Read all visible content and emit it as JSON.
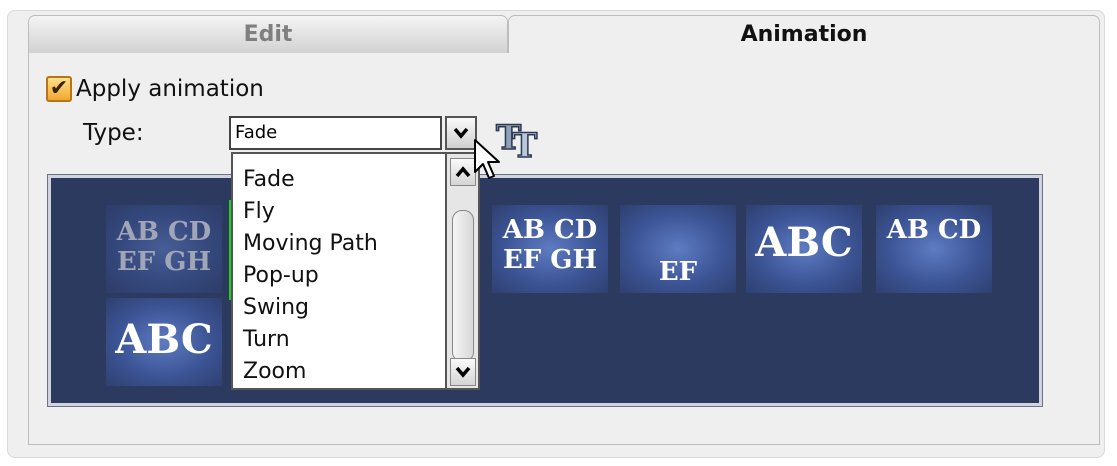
{
  "tabs": [
    {
      "label": "Edit",
      "active": false
    },
    {
      "label": "Animation",
      "active": true
    }
  ],
  "apply_animation": {
    "label": "Apply animation",
    "checked": true
  },
  "type_field": {
    "label": "Type:",
    "value": "Fade",
    "options": [
      "Fade",
      "Fly",
      "Moving Path",
      "Pop-up",
      "Swing",
      "Turn",
      "Zoom"
    ]
  },
  "preview": {
    "thumbnails": [
      {
        "line1": "AB CD",
        "line2": "EF GH"
      },
      {
        "line1": "AB CD",
        "line2": "EF GH"
      },
      {
        "line1": "EF",
        "line2": ""
      },
      {
        "line1": "ABC",
        "line2": ""
      },
      {
        "line1": "AB CD",
        "line2": ""
      },
      {
        "line1": "ABC",
        "line2": ""
      }
    ]
  },
  "icons": {
    "text_style": "text-style-icon",
    "dropdown": "chevron-down-icon",
    "scroll_up": "chevron-up-icon",
    "scroll_down": "chevron-down-icon",
    "cursor": "mouse-cursor-icon"
  },
  "colors": {
    "preview_background": "#2d3a60",
    "checkbox_fill": "#f0a830",
    "selection_indicator": "#1fd11f"
  }
}
